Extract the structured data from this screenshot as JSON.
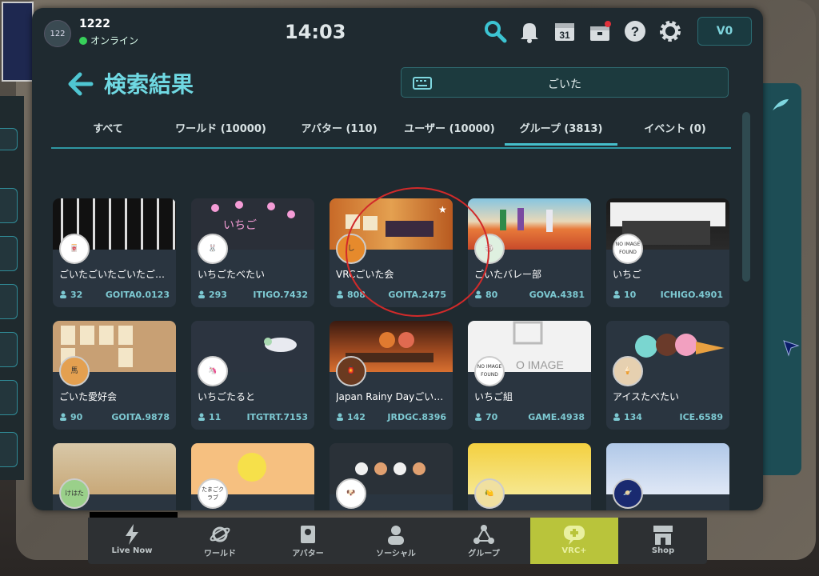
{
  "user": {
    "avatar_text": "122",
    "name": "1222",
    "status": "オンライン"
  },
  "clock": "14:03",
  "currency": "V0",
  "page_title": "検索結果",
  "search": {
    "query": "ごいた"
  },
  "tabs": [
    {
      "label": "すべて",
      "active": false
    },
    {
      "label": "ワールド (10000)",
      "active": false
    },
    {
      "label": "アバター (110)",
      "active": false
    },
    {
      "label": "ユーザー (10000)",
      "active": false
    },
    {
      "label": "グループ (3813)",
      "active": true
    },
    {
      "label": "イベント (0)",
      "active": false
    }
  ],
  "groups": [
    {
      "name": "ごいたごいたごいたごいたごいた",
      "members": "32",
      "code": "GOITA0.0123",
      "icon_text": "🀄"
    },
    {
      "name": "いちごたべたい",
      "members": "293",
      "code": "ITIGO.7432",
      "icon_text": "🐰"
    },
    {
      "name": "VRCごいた会",
      "members": "808",
      "code": "GOITA.2475",
      "icon_text": "し"
    },
    {
      "name": "ごいたバレー部",
      "members": "80",
      "code": "GOVA.4381",
      "icon_text": "🏐"
    },
    {
      "name": "いちご",
      "members": "10",
      "code": "ICHIGO.4901",
      "icon_text": "NO IMAGE FOUND"
    },
    {
      "name": "ごいた愛好会",
      "members": "90",
      "code": "GOITA.9878",
      "icon_text": "馬"
    },
    {
      "name": "いちごたると",
      "members": "11",
      "code": "ITGTRT.7153",
      "icon_text": "🦄"
    },
    {
      "name": "Japan Rainy Dayごいた部",
      "members": "142",
      "code": "JRDGC.8396",
      "icon_text": "🏮"
    },
    {
      "name": "いちご組",
      "members": "70",
      "code": "GAME.4938",
      "icon_text": "NO IMAGE FOUND"
    },
    {
      "name": "アイスたべたい",
      "members": "134",
      "code": "ICE.6589",
      "icon_text": "🍦"
    },
    {
      "name": "",
      "members": "",
      "code": "",
      "icon_text": "けはた"
    },
    {
      "name": "",
      "members": "",
      "code": "",
      "icon_text": "たまごクラブ"
    },
    {
      "name": "",
      "members": "",
      "code": "",
      "icon_text": "🐶"
    },
    {
      "name": "",
      "members": "",
      "code": "",
      "icon_text": "🍋"
    },
    {
      "name": "",
      "members": "",
      "code": "",
      "icon_text": "🪐"
    }
  ],
  "nav": [
    {
      "label": "Live Now"
    },
    {
      "label": "ワールド"
    },
    {
      "label": "アバター"
    },
    {
      "label": "ソーシャル"
    },
    {
      "label": "グループ"
    },
    {
      "label": "VRC+"
    },
    {
      "label": "Shop"
    }
  ],
  "colors": {
    "accent": "#46bfcb",
    "highlight_circle": "#d12a2a",
    "vrcplus": "#b9c43b"
  },
  "icons": [
    "search-icon",
    "bell-icon",
    "calendar-icon",
    "gift-icon",
    "help-icon",
    "gear-icon",
    "keyboard-icon",
    "back-arrow-icon",
    "person-icon"
  ]
}
